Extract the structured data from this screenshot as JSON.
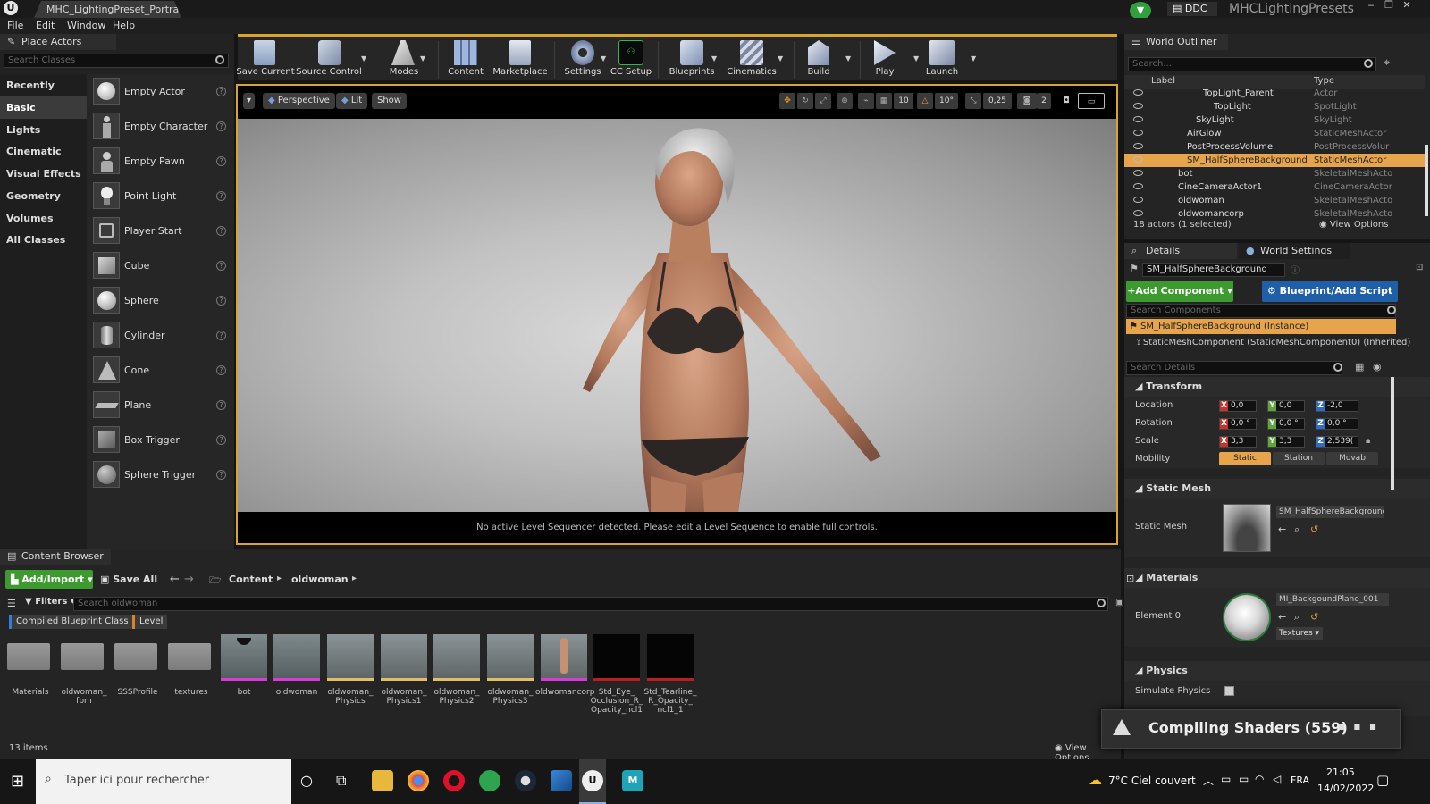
{
  "titlebar": {
    "app_logo": "U",
    "document_tab": "MHC_LightingPreset_Portrait",
    "ddc_label": "DDC",
    "project_name": "MHCLightingPresets"
  },
  "menu": [
    "File",
    "Edit",
    "Window",
    "Help"
  ],
  "place_actors": {
    "tab_label": "Place Actors",
    "search_placeholder": "Search Classes",
    "categories": [
      "Recently Placed",
      "Basic",
      "Lights",
      "Cinematic",
      "Visual Effects",
      "Geometry",
      "Volumes",
      "All Classes"
    ],
    "active_category": "Basic",
    "actors": [
      "Empty Actor",
      "Empty Character",
      "Empty Pawn",
      "Point Light",
      "Player Start",
      "Cube",
      "Sphere",
      "Cylinder",
      "Cone",
      "Plane",
      "Box Trigger",
      "Sphere Trigger"
    ]
  },
  "toolbar": {
    "buttons": [
      "Save Current",
      "Source Control",
      "Modes",
      "Content",
      "Marketplace",
      "Settings",
      "CC Setup",
      "Blueprints",
      "Cinematics",
      "Build",
      "Play",
      "Launch"
    ]
  },
  "viewport": {
    "perspective_label": "Perspective",
    "lit_label": "Lit",
    "show_label": "Show",
    "grid_snap": "10",
    "rotation_snap": "10°",
    "scale_snap": "0,25",
    "camera_speed": "2",
    "sequencer_message": "No active Level Sequencer detected. Please edit a Level Sequence to enable full controls."
  },
  "outliner": {
    "tab_label": "World Outliner",
    "search_placeholder": "Search...",
    "col_label": "Label",
    "col_type": "Type",
    "rows": [
      {
        "name": "TopLight_Parent",
        "type": "Actor",
        "indent": 2
      },
      {
        "name": "TopLight",
        "type": "SpotLight",
        "indent": 3
      },
      {
        "name": "SkyLight",
        "type": "SkyLight",
        "indent": 2
      },
      {
        "name": "AirGlow",
        "type": "StaticMeshActor",
        "indent": 1
      },
      {
        "name": "PostProcessVolume",
        "type": "PostProcessVolur",
        "indent": 1
      },
      {
        "name": "SM_HalfSphereBackground",
        "type": "StaticMeshActor",
        "indent": 1,
        "selected": true
      },
      {
        "name": "bot",
        "type": "SkeletalMeshActo",
        "indent": 0
      },
      {
        "name": "CineCameraActor1",
        "type": "CineCameraActor",
        "indent": 0
      },
      {
        "name": "oldwoman",
        "type": "SkeletalMeshActo",
        "indent": 0
      },
      {
        "name": "oldwomancorp",
        "type": "SkeletalMeshActo",
        "indent": 0
      }
    ],
    "status": "18 actors (1 selected)",
    "view_options": "View Options"
  },
  "details": {
    "tab_details": "Details",
    "tab_world_settings": "World Settings",
    "actor_name": "SM_HalfSphereBackground",
    "add_component": "+Add Component",
    "blueprint_script": "Blueprint/Add Script",
    "search_components_placeholder": "Search Components",
    "instance_row": "SM_HalfSphereBackground (Instance)",
    "component_row": "StaticMeshComponent (StaticMeshComponent0) (Inherited)",
    "search_details_placeholder": "Search Details",
    "transform": {
      "section": "Transform",
      "location_label": "Location",
      "rotation_label": "Rotation",
      "scale_label": "Scale",
      "mobility_label": "Mobility",
      "location": [
        "0,0",
        "0,0",
        "-2,0"
      ],
      "rotation": [
        "0,0 °",
        "0,0 °",
        "0,0 °"
      ],
      "scale": [
        "3,3",
        "3,3",
        "2,539("
      ],
      "mobility": [
        "Static",
        "Station",
        "Movab"
      ]
    },
    "static_mesh": {
      "section": "Static Mesh",
      "label": "Static Mesh",
      "value": "SM_HalfSphereBackgrounc"
    },
    "materials": {
      "section": "Materials",
      "element_label": "Element 0",
      "value": "MI_BackgoundPlane_001",
      "textures_label": "Textures"
    },
    "physics": {
      "section": "Physics",
      "simulate_label": "Simulate Physics"
    }
  },
  "content_browser": {
    "tab_label": "Content Browser",
    "add_import": "Add/Import",
    "save_all": "Save All",
    "path": [
      "Content",
      "oldwoman"
    ],
    "filters_label": "Filters",
    "search_placeholder": "Search oldwoman",
    "filter_chips": [
      "Compiled Blueprint Class",
      "Level"
    ],
    "assets": [
      {
        "label": "Materials",
        "kind": "folder"
      },
      {
        "label": "oldwoman_ fbm",
        "kind": "folder"
      },
      {
        "label": "SSSProfile",
        "kind": "folder"
      },
      {
        "label": "textures",
        "kind": "folder"
      },
      {
        "label": "bot",
        "kind": "mesh"
      },
      {
        "label": "oldwoman",
        "kind": "mesh"
      },
      {
        "label": "oldwoman_ Physics",
        "kind": "physics"
      },
      {
        "label": "oldwoman_ Physics1",
        "kind": "physics"
      },
      {
        "label": "oldwoman_ Physics2",
        "kind": "physics"
      },
      {
        "label": "oldwoman_ Physics3",
        "kind": "physics"
      },
      {
        "label": "oldwomancorp",
        "kind": "figure"
      },
      {
        "label": "Std_Eye_ Occlusion_R_ Opacity_ncl1",
        "kind": "dark"
      },
      {
        "label": "Std_Tearline_ R_Opacity_ ncl1_1",
        "kind": "dark"
      }
    ],
    "item_count": "13 items",
    "view_options": "View Options"
  },
  "toast": {
    "message": "Compiling Shaders (559)"
  },
  "taskbar": {
    "search_placeholder": "Taper ici pour rechercher",
    "weather": "7°C  Ciel couvert",
    "language": "FRA",
    "time": "21:05",
    "date": "14/02/2022"
  },
  "colors": {
    "accent": "#d7a52c",
    "selection": "#e6a54a",
    "add_green": "#3c9a2e",
    "blueprint_blue": "#1e5fa8"
  }
}
